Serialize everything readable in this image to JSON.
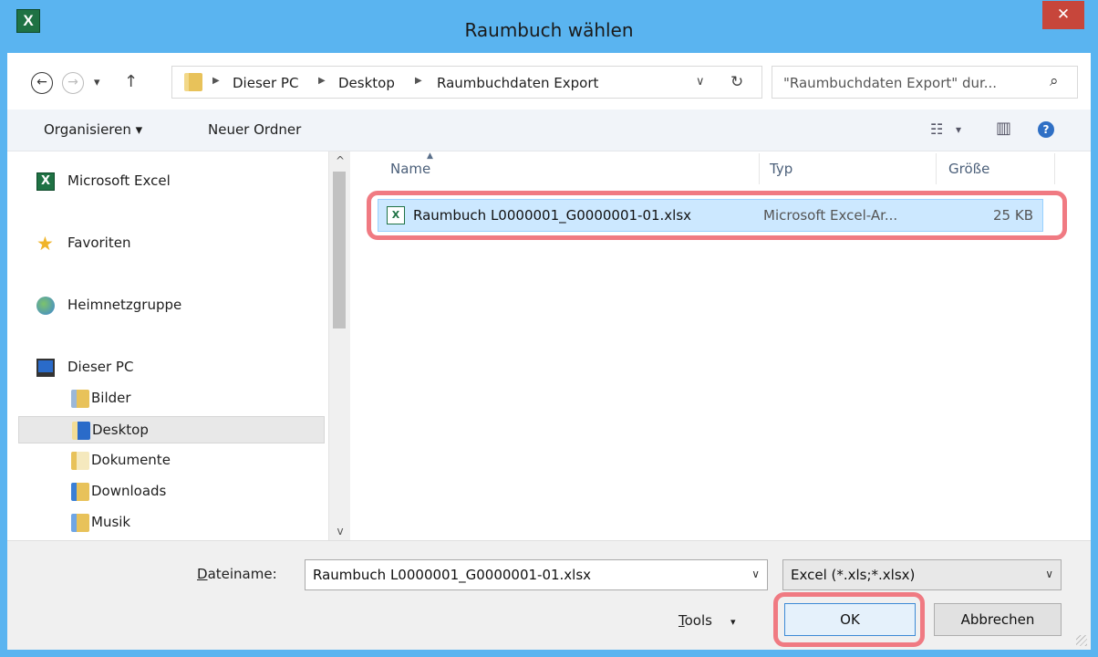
{
  "window": {
    "title": "Raumbuch wählen",
    "app_icon_label": "X",
    "close_symbol": "✕"
  },
  "address_bar": {
    "back_symbol": "←",
    "forward_symbol": "→",
    "recent_symbol": "▾",
    "up_symbol": "↑",
    "breadcrumbs": [
      "Dieser PC",
      "Desktop",
      "Raumbuchdaten Export"
    ],
    "separator": "▶",
    "dropdown_symbol": "∨",
    "refresh_symbol": "↻",
    "search_placeholder": "\"Raumbuchdaten Export\" dur...",
    "search_symbol": "⌕"
  },
  "toolbar": {
    "organize_label": "Organisieren ▾",
    "new_folder_label": "Neuer Ordner",
    "view_symbol": "☷",
    "view_dropdown_symbol": "▾",
    "preview_symbol": "▥",
    "help_symbol": "?"
  },
  "nav": {
    "items": [
      {
        "label": "Microsoft Excel",
        "icon": "excel-icon",
        "icon_text": "X"
      },
      {
        "label": "Favoriten",
        "icon": "star-icon",
        "icon_text": "★"
      },
      {
        "label": "Heimnetzgruppe",
        "icon": "homegroup-icon",
        "icon_text": ""
      },
      {
        "label": "Dieser PC",
        "icon": "computer-icon",
        "icon_text": ""
      }
    ],
    "sub_items": [
      {
        "label": "Bilder",
        "icon": "pictures-folder-icon"
      },
      {
        "label": "Desktop",
        "icon": "desktop-folder-icon",
        "selected": true
      },
      {
        "label": "Dokumente",
        "icon": "documents-folder-icon"
      },
      {
        "label": "Downloads",
        "icon": "downloads-folder-icon"
      },
      {
        "label": "Musik",
        "icon": "music-folder-icon"
      }
    ],
    "scroll_up_symbol": "^",
    "scroll_down_symbol": "v"
  },
  "file_list": {
    "columns": [
      "Name",
      "Typ",
      "Größe"
    ],
    "sort_symbol": "▲",
    "rows": [
      {
        "name": "Raumbuch L0000001_G0000001-01.xlsx",
        "type": "Microsoft Excel-Ar...",
        "size": "25 KB",
        "icon": "xlsx-file-icon",
        "icon_text": "X",
        "selected": true
      }
    ]
  },
  "bottom": {
    "filename_label_underlined": "D",
    "filename_label_rest": "ateiname:",
    "filename_value": "Raumbuch L0000001_G0000001-01.xlsx",
    "filename_dropdown_symbol": "∨",
    "filetype_value": "Excel (*.xls;*.xlsx)",
    "filetype_dropdown_symbol": "∨",
    "tools_underlined": "T",
    "tools_rest": "ools",
    "tools_dropdown_symbol": "▾",
    "ok_label": "OK",
    "cancel_label": "Abbrechen"
  },
  "colors": {
    "titlebar": "#5ab4f0",
    "close_button": "#c7463b",
    "selection": "#cce8ff",
    "highlight_annotation": "#f07a82"
  }
}
